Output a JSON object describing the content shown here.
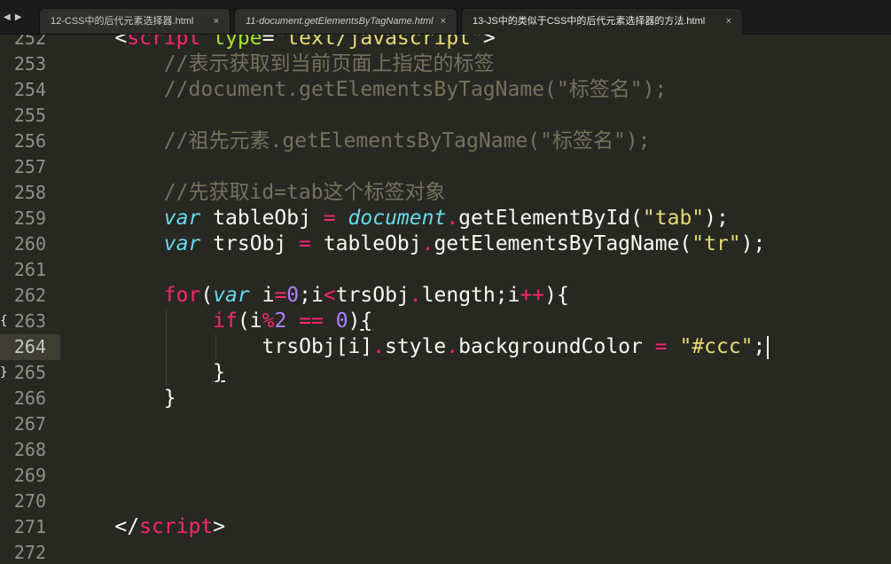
{
  "tabs": [
    {
      "label": "12-CSS中的后代元素选择器.html",
      "close": "×",
      "active": false,
      "italic": false
    },
    {
      "label": "11-document.getElementsByTagName.html",
      "close": "×",
      "active": false,
      "italic": true
    },
    {
      "label": "13-JS中的类似于CSS中的后代元素选择器的方法.html",
      "close": "×",
      "active": true,
      "italic": false
    }
  ],
  "tab_nav": "◀ ▶",
  "editor": {
    "current_line": "264",
    "lines": [
      {
        "n": "252",
        "code": [
          [
            "c-pl",
            "    <"
          ],
          [
            "c-tag",
            "script"
          ],
          [
            "c-pl",
            " "
          ],
          [
            "c-attr",
            "type"
          ],
          [
            "c-pl",
            "="
          ],
          [
            "c-str",
            "\"text/javascript\""
          ],
          [
            "c-pl",
            ">"
          ]
        ]
      },
      {
        "n": "253",
        "code": [
          [
            "c-com",
            "        //表示获取到当前页面上指定的标签"
          ]
        ]
      },
      {
        "n": "254",
        "code": [
          [
            "c-com",
            "        //document.getElementsByTagName(\"标签名\");"
          ]
        ]
      },
      {
        "n": "255",
        "code": []
      },
      {
        "n": "256",
        "code": [
          [
            "c-com",
            "        //祖先元素.getElementsByTagName(\"标签名\");"
          ]
        ]
      },
      {
        "n": "257",
        "code": []
      },
      {
        "n": "258",
        "code": [
          [
            "c-com",
            "        //先获取id=tab这个标签对象"
          ]
        ]
      },
      {
        "n": "259",
        "code": [
          [
            "c-pl",
            "        "
          ],
          [
            "c-sto",
            "var"
          ],
          [
            "c-pl",
            " tableObj "
          ],
          [
            "c-op",
            "="
          ],
          [
            "c-pl",
            " "
          ],
          [
            "c-sup",
            "document"
          ],
          [
            "c-op",
            "."
          ],
          [
            "c-fn",
            "getElementById"
          ],
          [
            "c-pl",
            "("
          ],
          [
            "c-str",
            "\"tab\""
          ],
          [
            "c-pl",
            ");"
          ]
        ]
      },
      {
        "n": "260",
        "code": [
          [
            "c-pl",
            "        "
          ],
          [
            "c-sto",
            "var"
          ],
          [
            "c-pl",
            " trsObj "
          ],
          [
            "c-op",
            "="
          ],
          [
            "c-pl",
            " tableObj"
          ],
          [
            "c-op",
            "."
          ],
          [
            "c-fn",
            "getElementsByTagName"
          ],
          [
            "c-pl",
            "("
          ],
          [
            "c-str",
            "\"tr\""
          ],
          [
            "c-pl",
            ");"
          ]
        ]
      },
      {
        "n": "261",
        "code": []
      },
      {
        "n": "262",
        "code": [
          [
            "c-pl",
            "        "
          ],
          [
            "c-kw",
            "for"
          ],
          [
            "c-pl",
            "("
          ],
          [
            "c-sto",
            "var"
          ],
          [
            "c-pl",
            " i"
          ],
          [
            "c-op",
            "="
          ],
          [
            "c-num",
            "0"
          ],
          [
            "c-pl",
            ";i"
          ],
          [
            "c-op",
            "<"
          ],
          [
            "c-pl",
            "trsObj"
          ],
          [
            "c-op",
            "."
          ],
          [
            "c-pl",
            "length;i"
          ],
          [
            "c-op",
            "++"
          ],
          [
            "c-pl",
            "){"
          ]
        ]
      },
      {
        "n": "263",
        "code": [
          [
            "c-pl",
            "            "
          ],
          [
            "c-kw",
            "if"
          ],
          [
            "c-pl",
            "(i"
          ],
          [
            "c-op",
            "%"
          ],
          [
            "c-num",
            "2"
          ],
          [
            "c-pl",
            " "
          ],
          [
            "c-op",
            "=="
          ],
          [
            "c-pl",
            " "
          ],
          [
            "c-num",
            "0"
          ],
          [
            "c-pl",
            ")"
          ],
          [
            "c-pl ul",
            "{"
          ]
        ]
      },
      {
        "n": "264",
        "code": [
          [
            "c-pl",
            "                trsObj[i]"
          ],
          [
            "c-op",
            "."
          ],
          [
            "c-pl",
            "style"
          ],
          [
            "c-op",
            "."
          ],
          [
            "c-pl",
            "backgroundColor "
          ],
          [
            "c-op",
            "="
          ],
          [
            "c-pl",
            " "
          ],
          [
            "c-str",
            "\"#ccc\""
          ],
          [
            "c-pl",
            ";"
          ]
        ]
      },
      {
        "n": "265",
        "code": [
          [
            "c-pl",
            "            "
          ],
          [
            "c-pl ul",
            "}"
          ]
        ]
      },
      {
        "n": "266",
        "code": [
          [
            "c-pl",
            "        }"
          ]
        ]
      },
      {
        "n": "267",
        "code": []
      },
      {
        "n": "268",
        "code": []
      },
      {
        "n": "269",
        "code": []
      },
      {
        "n": "270",
        "code": []
      },
      {
        "n": "271",
        "code": [
          [
            "c-pl",
            "    </"
          ],
          [
            "c-tag",
            "script"
          ],
          [
            "c-pl",
            ">"
          ]
        ]
      },
      {
        "n": "272",
        "code": []
      }
    ]
  }
}
